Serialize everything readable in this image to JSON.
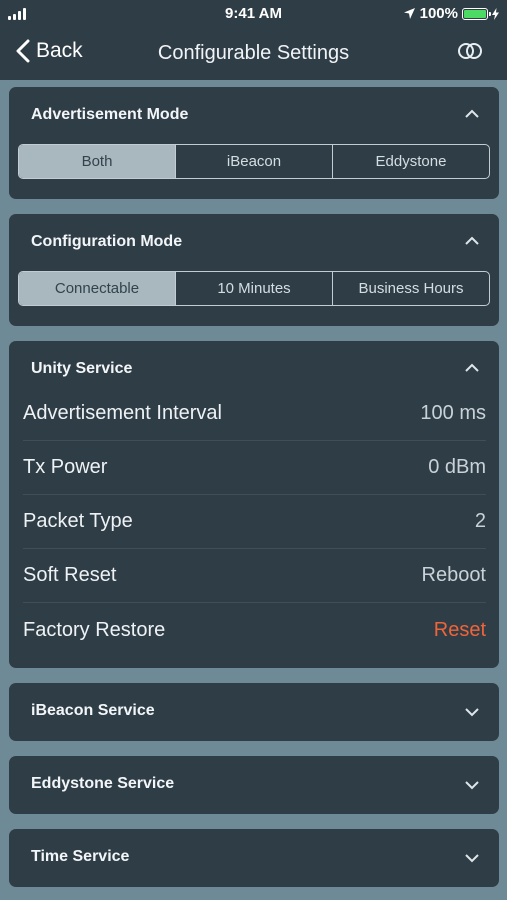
{
  "status_bar": {
    "time": "9:41 AM",
    "battery_percent": "100%"
  },
  "nav": {
    "back_label": "Back",
    "title": "Configurable Settings"
  },
  "advertisement_mode": {
    "title": "Advertisement Mode",
    "options": [
      "Both",
      "iBeacon",
      "Eddystone"
    ],
    "selected": "Both"
  },
  "configuration_mode": {
    "title": "Configuration Mode",
    "options": [
      "Connectable",
      "10 Minutes",
      "Business Hours"
    ],
    "selected": "Connectable"
  },
  "unity_service": {
    "title": "Unity Service",
    "rows": [
      {
        "label": "Advertisement Interval",
        "value": "100 ms"
      },
      {
        "label": "Tx Power",
        "value": "0 dBm"
      },
      {
        "label": "Packet Type",
        "value": "2"
      },
      {
        "label": "Soft Reset",
        "value": "Reboot"
      },
      {
        "label": "Factory Restore",
        "value": "Reset"
      }
    ]
  },
  "collapsed_sections": [
    {
      "title": "iBeacon Service"
    },
    {
      "title": "Eddystone Service"
    },
    {
      "title": "Time Service"
    }
  ],
  "colors": {
    "accent_danger": "#f0643a",
    "card_bg": "#2f3d46",
    "page_bg": "#6f8a97",
    "battery": "#4cd964"
  }
}
